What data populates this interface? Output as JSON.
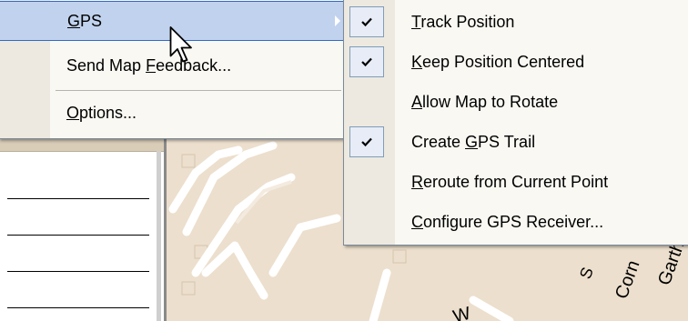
{
  "main_menu": {
    "items": [
      {
        "pre": "",
        "accel": "G",
        "post": "PS"
      },
      {
        "pre": "Send Map ",
        "accel": "F",
        "post": "eedback..."
      },
      {
        "pre": "",
        "accel": "O",
        "post": "ptions..."
      }
    ]
  },
  "gps_submenu": {
    "items": [
      {
        "pre": "",
        "accel": "T",
        "post": "rack Position",
        "checked": true
      },
      {
        "pre": "",
        "accel": "K",
        "post": "eep Position Centered",
        "checked": true
      },
      {
        "pre": "",
        "accel": "A",
        "post": "llow Map to Rotate",
        "checked": false
      },
      {
        "pre": "Create ",
        "accel": "G",
        "post": "PS Trail",
        "checked": true
      },
      {
        "pre": "",
        "accel": "R",
        "post": "eroute from Current Point",
        "checked": false
      },
      {
        "pre": "",
        "accel": "C",
        "post": "onfigure GPS Receiver...",
        "checked": false
      }
    ]
  },
  "map": {
    "street_labels": [
      "S",
      "Corn",
      "Garth",
      "W"
    ]
  },
  "colors": {
    "menu_bg": "#f9f8f3",
    "highlight_bg": "#c1d2ee",
    "highlight_border": "#316ac5",
    "map_bg": "#ecdfcd",
    "road": "#ffffff"
  }
}
